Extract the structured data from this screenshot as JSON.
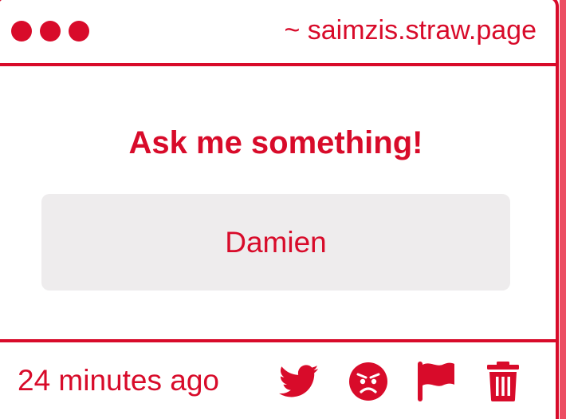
{
  "window": {
    "url": "~ saimzis.straw.page"
  },
  "main": {
    "title": "Ask me something!",
    "answer": "Damien"
  },
  "footer": {
    "timestamp": "24 minutes ago",
    "actions": [
      {
        "icon": "twitter-icon"
      },
      {
        "icon": "angry-face-icon"
      },
      {
        "icon": "flag-icon"
      },
      {
        "icon": "trash-icon"
      }
    ]
  },
  "colors": {
    "accent": "#d80b2a",
    "edge": "#ec4e63",
    "answer_background": "#eeeced",
    "background": "#ffffff"
  }
}
